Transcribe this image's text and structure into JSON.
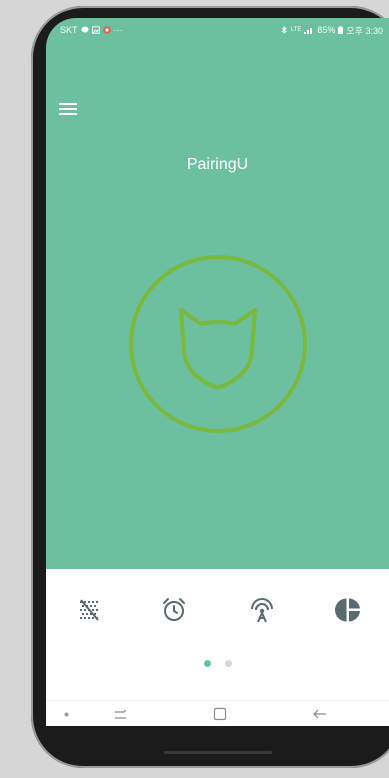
{
  "statusbar": {
    "carrier": "SKT",
    "ellipsis": "···",
    "network": "LTE",
    "battery": "85%",
    "time": "오후 3:30"
  },
  "app": {
    "title": "PairingU"
  },
  "feature_buttons": [
    {
      "icon": "no-sound-icon"
    },
    {
      "icon": "alarm-clock-icon"
    },
    {
      "icon": "signal-broadcast-icon"
    },
    {
      "icon": "pie-chart-icon"
    }
  ],
  "pager": {
    "count": 2,
    "active": 0
  },
  "nav": [
    "recent-apps",
    "home",
    "back"
  ],
  "colors": {
    "accent": "#6cc0a0",
    "logo_stroke": "#7bb83e",
    "icon": "#5a6b70"
  }
}
